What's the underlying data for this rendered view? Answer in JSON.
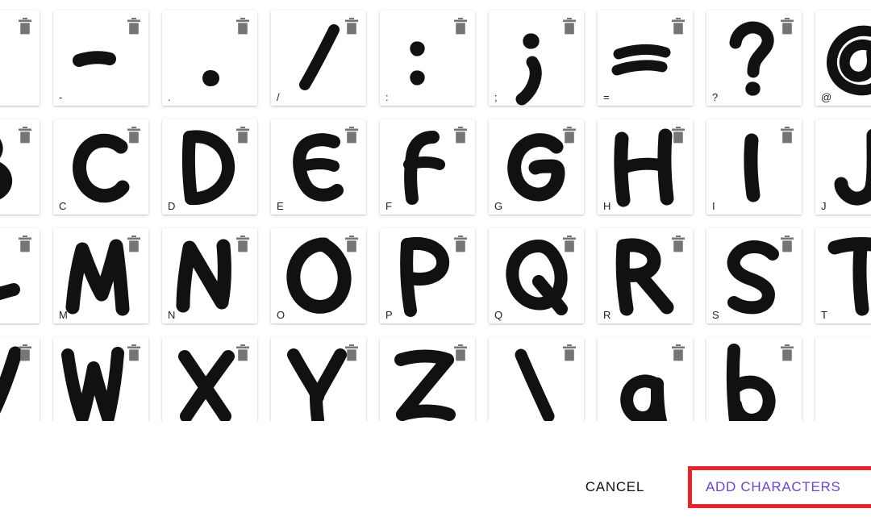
{
  "dialog": {
    "name": "add-characters-dialog",
    "actions": {
      "cancel_label": "CANCEL",
      "add_label": "ADD CHARACTERS"
    },
    "highlight_color": "#e8232a",
    "accent_color": "#6c43d4",
    "trash_icon_color": "#757575",
    "glyph_color": "#111111"
  },
  "grid": {
    "columns": 9,
    "rows": [
      {
        "row_index": 0,
        "cells": [
          {
            "label": "",
            "glyph": "",
            "partial": true,
            "clipped_top": true
          },
          {
            "label": "",
            "glyph": "",
            "partial": true,
            "clipped_top": true
          },
          {
            "label": "",
            "glyph": "",
            "partial": true,
            "clipped_top": true
          },
          {
            "label": "",
            "glyph": "",
            "partial": true,
            "clipped_top": true
          },
          {
            "label": "",
            "glyph": "",
            "partial": true,
            "clipped_top": true
          },
          {
            "label": "",
            "glyph": "",
            "partial": true,
            "clipped_top": true
          },
          {
            "label": "",
            "glyph": "",
            "partial": true,
            "clipped_top": true
          },
          {
            "label": "",
            "glyph": "",
            "partial": true,
            "clipped_top": true
          },
          {
            "label": "",
            "glyph": "",
            "partial": true,
            "clipped_top": true
          }
        ]
      },
      {
        "row_index": 1,
        "cells": [
          {
            "label": "",
            "glyph": ",",
            "partial": true
          },
          {
            "label": "-",
            "glyph": "-",
            "partial": false
          },
          {
            "label": ".",
            "glyph": ".",
            "partial": false
          },
          {
            "label": "/",
            "glyph": "/",
            "partial": false
          },
          {
            "label": ":",
            "glyph": ":",
            "partial": false
          },
          {
            "label": ";",
            "glyph": ";",
            "partial": false
          },
          {
            "label": "=",
            "glyph": "=",
            "partial": false
          },
          {
            "label": "?",
            "glyph": "?",
            "partial": false
          },
          {
            "label": "@",
            "glyph": "@",
            "partial": true
          }
        ]
      },
      {
        "row_index": 2,
        "cells": [
          {
            "label": "",
            "glyph": "B",
            "partial": true
          },
          {
            "label": "C",
            "glyph": "C",
            "partial": false
          },
          {
            "label": "D",
            "glyph": "D",
            "partial": false
          },
          {
            "label": "E",
            "glyph": "E",
            "partial": false
          },
          {
            "label": "F",
            "glyph": "F",
            "partial": false
          },
          {
            "label": "G",
            "glyph": "G",
            "partial": false
          },
          {
            "label": "H",
            "glyph": "H",
            "partial": false
          },
          {
            "label": "I",
            "glyph": "I",
            "partial": false
          },
          {
            "label": "J",
            "glyph": "J",
            "partial": true
          }
        ]
      },
      {
        "row_index": 3,
        "cells": [
          {
            "label": "",
            "glyph": "L",
            "partial": true
          },
          {
            "label": "M",
            "glyph": "M",
            "partial": false
          },
          {
            "label": "N",
            "glyph": "N",
            "partial": false
          },
          {
            "label": "O",
            "glyph": "O",
            "partial": false
          },
          {
            "label": "P",
            "glyph": "P",
            "partial": false
          },
          {
            "label": "Q",
            "glyph": "Q",
            "partial": false
          },
          {
            "label": "R",
            "glyph": "R",
            "partial": false
          },
          {
            "label": "S",
            "glyph": "S",
            "partial": false
          },
          {
            "label": "T",
            "glyph": "T",
            "partial": true
          }
        ]
      },
      {
        "row_index": 4,
        "cells": [
          {
            "label": "",
            "glyph": "V",
            "partial": true,
            "clipped_bottom": true
          },
          {
            "label": "",
            "glyph": "W",
            "partial": false,
            "clipped_bottom": true
          },
          {
            "label": "",
            "glyph": "X",
            "partial": false,
            "clipped_bottom": true
          },
          {
            "label": "",
            "glyph": "Y",
            "partial": false,
            "clipped_bottom": true
          },
          {
            "label": "",
            "glyph": "Z",
            "partial": false,
            "clipped_bottom": true
          },
          {
            "label": "",
            "glyph": "\\",
            "partial": false,
            "clipped_bottom": true
          },
          {
            "label": "",
            "glyph": "a",
            "partial": false,
            "clipped_bottom": true
          },
          {
            "label": "",
            "glyph": "b",
            "partial": false,
            "clipped_bottom": true
          },
          {
            "label": "",
            "glyph": "",
            "partial": true,
            "clipped_bottom": true
          }
        ]
      }
    ]
  }
}
